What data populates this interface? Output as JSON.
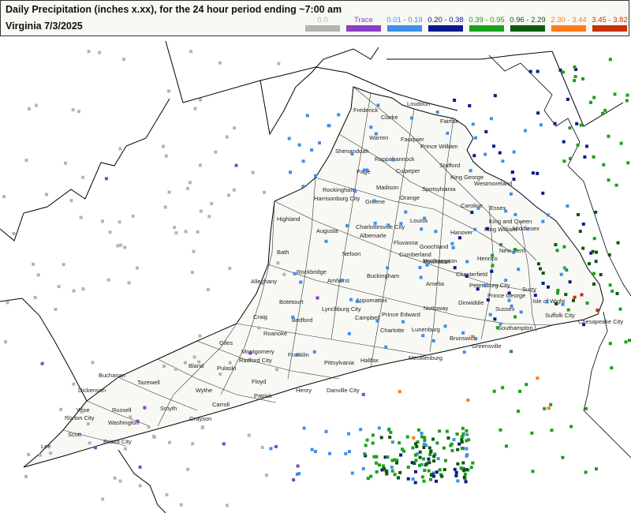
{
  "header": {
    "title": "Daily Precipitation (inches  x.xx),  for the 24 hour period ending ~7:00 am",
    "subtitle": "Virginia 7/3/2025"
  },
  "legend": [
    {
      "label": "0.0",
      "color": "#b4b4b4"
    },
    {
      "label": "Trace",
      "color": "#8a3fc4"
    },
    {
      "label": "0.01 - 0.19",
      "color": "#3f8fe8"
    },
    {
      "label": "0.20 - 0.38",
      "color": "#0a1a8c"
    },
    {
      "label": "0.39 - 0.95",
      "color": "#1aa01a"
    },
    {
      "label": "0.96 - 2.29",
      "color": "#0a5a0a"
    },
    {
      "label": "2.30 - 3.44",
      "color": "#ff7a1a"
    },
    {
      "label": "3.45 - 3.82",
      "color": "#c83200"
    }
  ],
  "counties": [
    "Frederick",
    "Clarke",
    "Loudoun",
    "Warren",
    "Fairfax",
    "Fauquier",
    "Prince William",
    "Shenandoah",
    "Rappahannock",
    "Stafford",
    "Page",
    "Culpeper",
    "King George",
    "Westmoreland",
    "Rockingham",
    "Madison",
    "Spotsylvania",
    "Harrisonburg City",
    "Greene",
    "Orange",
    "Caroline",
    "Essex",
    "Highland",
    "Augusta",
    "Charlottesville City",
    "Louisa",
    "Albemarle",
    "Hanover",
    "King and Queen",
    "King William",
    "Middlesex",
    "Fluvanna",
    "Goochland",
    "Northampton",
    "Bath",
    "Nelson",
    "Cumberland",
    "Powhatan",
    "Henrico",
    "New Kent",
    "Rockbridge",
    "Buckingham",
    "Chesterfield",
    "Alleghany",
    "Amherst",
    "Amelia",
    "Petersburg City",
    "Prince George",
    "Surry",
    "Botetourt",
    "Lynchburg City",
    "Appomattox",
    "Nottoway",
    "Dinwiddie",
    "Sussex",
    "Isle of Wight",
    "Suffolk City",
    "Chesapeake City",
    "Craig",
    "Bedford",
    "Campbell",
    "Prince Edward",
    "Roanoke",
    "Charlotte",
    "Lunenburg",
    "Southampton",
    "Giles",
    "Montgomery",
    "Brunswick",
    "Greensville",
    "Franklin",
    "Radford City",
    "Pittsylvania",
    "Halifax",
    "Mecklenburg",
    "Bland",
    "Pulaski",
    "Floyd",
    "Buchanan",
    "Tazewell",
    "Wythe",
    "Carroll",
    "Dickenson",
    "Patrick",
    "Henry",
    "Danville City",
    "Russell",
    "Smyth",
    "Wise",
    "Norton City",
    "Washington",
    "Grayson",
    "Scott",
    "Lee",
    "Bristol City"
  ]
}
